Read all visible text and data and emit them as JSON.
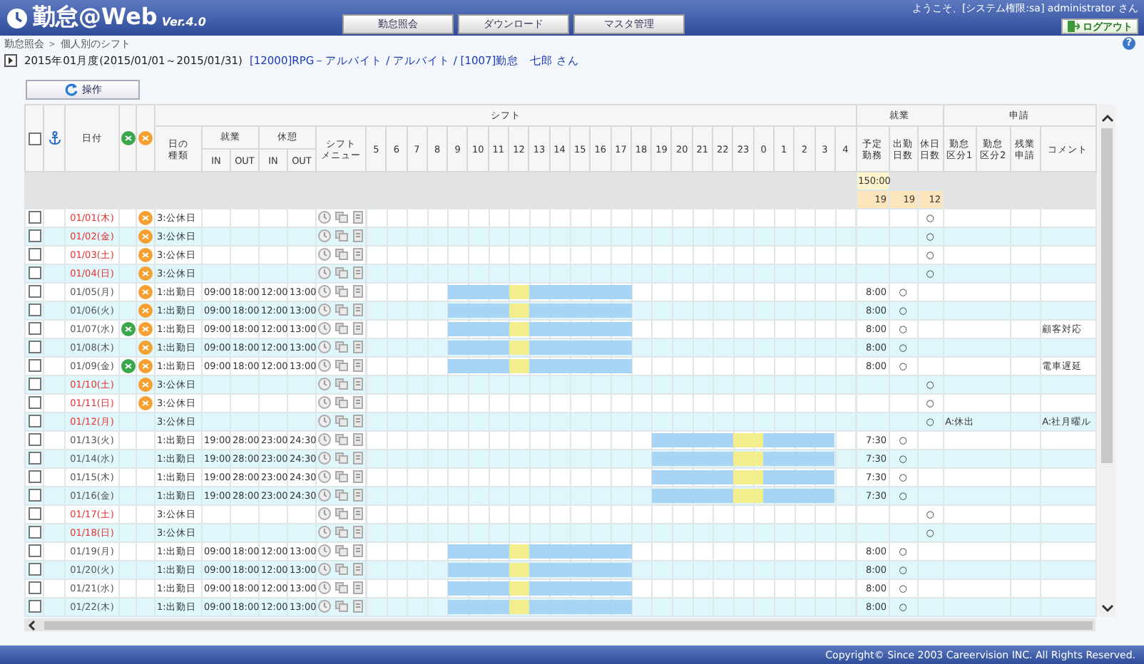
{
  "header": {
    "logo": "勤怠@Web",
    "version": "Ver.4.0",
    "nav": [
      {
        "label": "勤怠照会"
      },
      {
        "label": "ダウンロード"
      },
      {
        "label": "マスタ管理"
      }
    ],
    "welcome": "ようこそ、[システム権限:sa] administrator さん",
    "logout": "ログアウト"
  },
  "breadcrumb": "勤怠照会 ＞ 個人別のシフト",
  "help": "?",
  "period": "2015年01月度(2015/01/01～2015/01/31)",
  "employee_link": "[12000]RPG－アルバイト / アルバイト / [1007]勤怠　七郎 さん",
  "operation_button": "操作",
  "table": {
    "select_all": {
      "checked": false
    },
    "head": {
      "date": "日付",
      "day_type": [
        "日の",
        "種類"
      ],
      "work": "就業",
      "rest": "休憩",
      "work_in": "IN",
      "work_out": "OUT",
      "rest_in": "IN",
      "rest_out": "OUT",
      "shift_menu": [
        "シフト",
        "メニュー"
      ],
      "shift": "シフト",
      "result": "就業",
      "request": "申請",
      "hours": [
        "5",
        "6",
        "7",
        "8",
        "9",
        "10",
        "11",
        "12",
        "13",
        "14",
        "15",
        "16",
        "17",
        "18",
        "19",
        "20",
        "21",
        "22",
        "23",
        "0",
        "1",
        "2",
        "3",
        "4"
      ],
      "right_columns": [
        [
          "予定",
          "勤務"
        ],
        [
          "出勤",
          "日数"
        ],
        [
          "休日",
          "日数"
        ],
        [
          "勤怠",
          "区分1"
        ],
        [
          "勤怠",
          "区分2"
        ],
        [
          "残業",
          "申請"
        ],
        [
          "コメント"
        ]
      ]
    },
    "totals": {
      "planned": "150:00",
      "counts": [
        "19",
        "19",
        "12"
      ]
    },
    "rows": [
      {
        "checked": false,
        "date": "01/01(木)",
        "holiday": true,
        "flag_a": false,
        "flag_b": true,
        "day_type": "3:公休日",
        "holiday_day": "○"
      },
      {
        "checked": false,
        "date": "01/02(金)",
        "holiday": true,
        "flag_a": false,
        "flag_b": true,
        "day_type": "3:公休日",
        "holiday_day": "○"
      },
      {
        "checked": false,
        "date": "01/03(土)",
        "holiday": true,
        "flag_a": false,
        "flag_b": true,
        "day_type": "3:公休日",
        "holiday_day": "○"
      },
      {
        "checked": false,
        "date": "01/04(日)",
        "holiday": true,
        "flag_a": false,
        "flag_b": true,
        "day_type": "3:公休日",
        "holiday_day": "○"
      },
      {
        "checked": false,
        "date": "01/05(月)",
        "holiday": false,
        "flag_a": false,
        "flag_b": true,
        "day_type": "1:出勤日",
        "work_in": "09:00",
        "work_out": "18:00",
        "rest_in": "12:00",
        "rest_out": "13:00",
        "planned": "8:00",
        "attend": "○"
      },
      {
        "checked": false,
        "date": "01/06(火)",
        "holiday": false,
        "flag_a": false,
        "flag_b": true,
        "day_type": "1:出勤日",
        "work_in": "09:00",
        "work_out": "18:00",
        "rest_in": "12:00",
        "rest_out": "13:00",
        "planned": "8:00",
        "attend": "○"
      },
      {
        "checked": false,
        "date": "01/07(水)",
        "holiday": false,
        "flag_a": true,
        "flag_b": true,
        "day_type": "1:出勤日",
        "work_in": "09:00",
        "work_out": "18:00",
        "rest_in": "12:00",
        "rest_out": "13:00",
        "planned": "8:00",
        "attend": "○",
        "comment": "顧客対応"
      },
      {
        "checked": false,
        "date": "01/08(木)",
        "holiday": false,
        "flag_a": false,
        "flag_b": true,
        "day_type": "1:出勤日",
        "work_in": "09:00",
        "work_out": "18:00",
        "rest_in": "12:00",
        "rest_out": "13:00",
        "planned": "8:00",
        "attend": "○"
      },
      {
        "checked": false,
        "date": "01/09(金)",
        "holiday": false,
        "flag_a": true,
        "flag_b": true,
        "day_type": "1:出勤日",
        "work_in": "09:00",
        "work_out": "18:00",
        "rest_in": "12:00",
        "rest_out": "13:00",
        "planned": "8:00",
        "attend": "○",
        "comment": "電車遅延"
      },
      {
        "checked": false,
        "date": "01/10(土)",
        "holiday": true,
        "flag_a": false,
        "flag_b": true,
        "day_type": "3:公休日",
        "holiday_day": "○"
      },
      {
        "checked": false,
        "date": "01/11(日)",
        "holiday": true,
        "flag_a": false,
        "flag_b": true,
        "day_type": "3:公休日",
        "holiday_day": "○"
      },
      {
        "checked": false,
        "date": "01/12(月)",
        "holiday": true,
        "flag_a": false,
        "flag_b": false,
        "day_type": "3:公休日",
        "holiday_day": "○",
        "category_1": "A:休出",
        "comment": "A:社月曜ル"
      },
      {
        "checked": false,
        "date": "01/13(火)",
        "holiday": false,
        "flag_a": false,
        "flag_b": false,
        "day_type": "1:出勤日",
        "work_in": "19:00",
        "work_out": "28:00",
        "rest_in": "23:00",
        "rest_out": "24:30",
        "planned": "7:30",
        "attend": "○"
      },
      {
        "checked": false,
        "date": "01/14(水)",
        "holiday": false,
        "flag_a": false,
        "flag_b": false,
        "day_type": "1:出勤日",
        "work_in": "19:00",
        "work_out": "28:00",
        "rest_in": "23:00",
        "rest_out": "24:30",
        "planned": "7:30",
        "attend": "○"
      },
      {
        "checked": false,
        "date": "01/15(木)",
        "holiday": false,
        "flag_a": false,
        "flag_b": false,
        "day_type": "1:出勤日",
        "work_in": "19:00",
        "work_out": "28:00",
        "rest_in": "23:00",
        "rest_out": "24:30",
        "planned": "7:30",
        "attend": "○"
      },
      {
        "checked": false,
        "date": "01/16(金)",
        "holiday": false,
        "flag_a": false,
        "flag_b": false,
        "day_type": "1:出勤日",
        "work_in": "19:00",
        "work_out": "28:00",
        "rest_in": "23:00",
        "rest_out": "24:30",
        "planned": "7:30",
        "attend": "○"
      },
      {
        "checked": false,
        "date": "01/17(土)",
        "holiday": true,
        "flag_a": false,
        "flag_b": false,
        "day_type": "3:公休日",
        "holiday_day": "○"
      },
      {
        "checked": false,
        "date": "01/18(日)",
        "holiday": true,
        "flag_a": false,
        "flag_b": false,
        "day_type": "3:公休日",
        "holiday_day": "○"
      },
      {
        "checked": false,
        "date": "01/19(月)",
        "holiday": false,
        "flag_a": false,
        "flag_b": false,
        "day_type": "1:出勤日",
        "work_in": "09:00",
        "work_out": "18:00",
        "rest_in": "12:00",
        "rest_out": "13:00",
        "planned": "8:00",
        "attend": "○"
      },
      {
        "checked": false,
        "date": "01/20(火)",
        "holiday": false,
        "flag_a": false,
        "flag_b": false,
        "day_type": "1:出勤日",
        "work_in": "09:00",
        "work_out": "18:00",
        "rest_in": "12:00",
        "rest_out": "13:00",
        "planned": "8:00",
        "attend": "○"
      },
      {
        "checked": false,
        "date": "01/21(水)",
        "holiday": false,
        "flag_a": false,
        "flag_b": false,
        "day_type": "1:出勤日",
        "work_in": "09:00",
        "work_out": "18:00",
        "rest_in": "12:00",
        "rest_out": "13:00",
        "planned": "8:00",
        "attend": "○"
      },
      {
        "checked": false,
        "date": "01/22(木)",
        "holiday": false,
        "flag_a": false,
        "flag_b": false,
        "day_type": "1:出勤日",
        "work_in": "09:00",
        "work_out": "18:00",
        "rest_in": "12:00",
        "rest_out": "13:00",
        "planned": "8:00",
        "attend": "○"
      }
    ]
  },
  "footer": "Copyright© Since 2003 Careervision INC. All Rights Reserved."
}
